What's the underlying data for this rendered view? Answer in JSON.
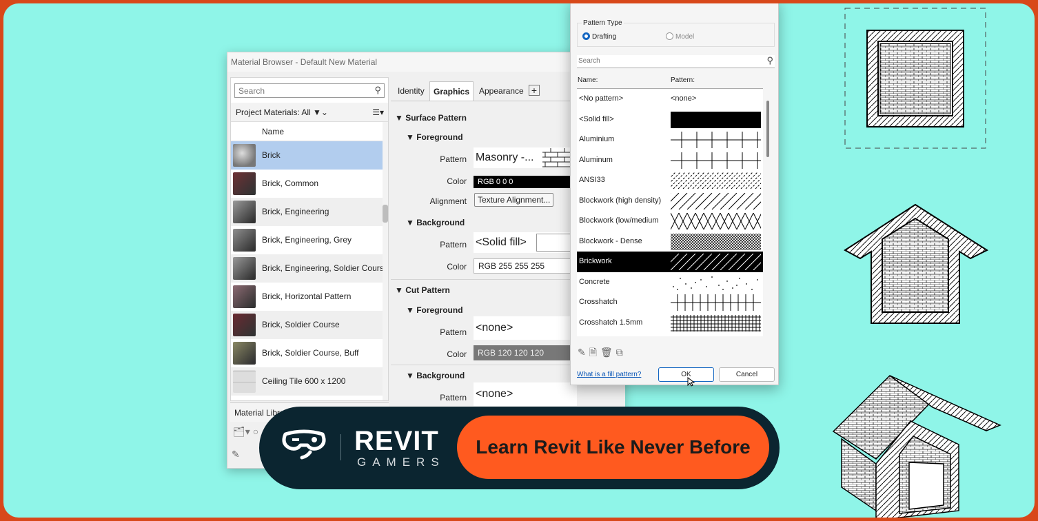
{
  "material_browser": {
    "title": "Material Browser - Default New Material",
    "search_placeholder": "Search",
    "project_filter": "Project Materials: All",
    "column_name": "Name",
    "materials": [
      {
        "name": "Brick",
        "color": "#8a8a8a"
      },
      {
        "name": "Brick, Common",
        "color": "#6e3135"
      },
      {
        "name": "Brick, Engineering",
        "color": "#9a9a9a"
      },
      {
        "name": "Brick, Engineering, Grey",
        "color": "#8f8f8f"
      },
      {
        "name": "Brick, Engineering, Soldier Course",
        "color": "#999999"
      },
      {
        "name": "Brick, Horizontal Pattern",
        "color": "#8c6a72"
      },
      {
        "name": "Brick, Soldier Course",
        "color": "#6a2a31"
      },
      {
        "name": "Brick, Soldier Course, Buff",
        "color": "#8a8864"
      },
      {
        "name": "Ceiling Tile 600 x 1200",
        "color": "#d6d6d6"
      }
    ],
    "library_label": "Material Libra",
    "tabs": [
      "Identity",
      "Graphics",
      "Appearance"
    ],
    "active_tab": "Graphics",
    "surface_pattern": {
      "header": "Surface Pattern",
      "foreground": {
        "header": "Foreground",
        "pattern_label": "Pattern",
        "pattern_value": "Masonry -...",
        "color_label": "Color",
        "color_value": "RGB 0 0 0",
        "alignment_label": "Alignment",
        "alignment_button": "Texture Alignment..."
      },
      "background": {
        "header": "Background",
        "pattern_label": "Pattern",
        "pattern_value": "<Solid fill>",
        "color_label": "Color",
        "color_value": "RGB 255 255 255"
      }
    },
    "cut_pattern": {
      "header": "Cut Pattern",
      "foreground": {
        "header": "Foreground",
        "pattern_label": "Pattern",
        "pattern_value": "<none>",
        "color_label": "Color",
        "color_value": "RGB 120 120 120"
      },
      "background": {
        "header": "Background",
        "pattern_label": "Pattern",
        "pattern_value": "<none>"
      }
    }
  },
  "fill_patterns": {
    "pattern_type_label": "Pattern Type",
    "drafting_label": "Drafting",
    "model_label": "Model",
    "selected_type": "Drafting",
    "search_placeholder": "Search",
    "col_name": "Name:",
    "col_pattern": "Pattern:",
    "patterns": [
      {
        "name": "<No pattern>",
        "preview": "<none>",
        "style": "text"
      },
      {
        "name": "<Solid fill>",
        "style": "solid"
      },
      {
        "name": "Aluminium",
        "style": "grid-v"
      },
      {
        "name": "Aluminum",
        "style": "grid-v"
      },
      {
        "name": "ANSI33",
        "style": "diag-dash"
      },
      {
        "name": "Blockwork (high density)",
        "style": "diag"
      },
      {
        "name": "Blockwork (low/medium",
        "style": "zigzag"
      },
      {
        "name": "Blockwork - Dense",
        "style": "crosshatch-fine"
      },
      {
        "name": "Brickwork",
        "style": "diag-inv"
      },
      {
        "name": "Concrete",
        "style": "dots"
      },
      {
        "name": "Crosshatch",
        "style": "plus"
      },
      {
        "name": "Crosshatch 1.5mm",
        "style": "grid-fine"
      }
    ],
    "selected_pattern": "Brickwork",
    "help_link": "What is a fill pattern?",
    "ok_label": "OK",
    "cancel_label": "Cancel"
  },
  "banner": {
    "brand_main": "REVIT",
    "brand_sub": "GAMERS",
    "cta": "Learn Revit Like Never Before",
    "accent": "#ff5a1f"
  }
}
